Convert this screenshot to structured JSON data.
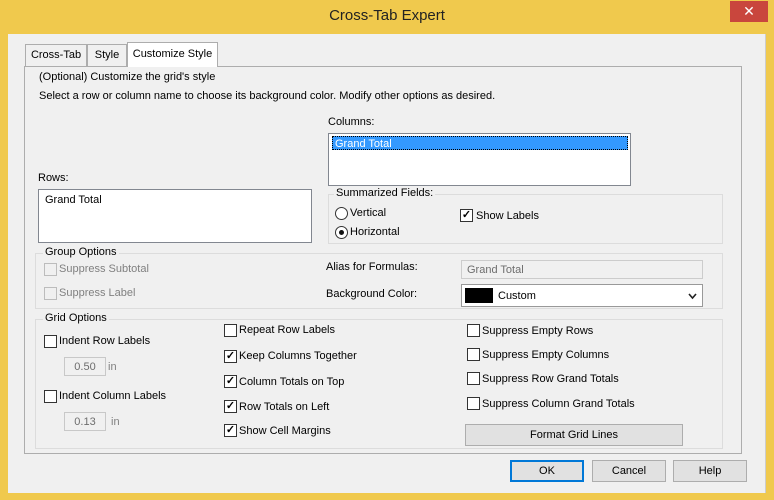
{
  "window": {
    "title": "Cross-Tab Expert",
    "close_glyph": "✕"
  },
  "tabs": [
    {
      "label": "Cross-Tab"
    },
    {
      "label": "Style"
    },
    {
      "label": "Customize Style",
      "active": true
    }
  ],
  "intro": {
    "line1": "(Optional) Customize the grid's style",
    "line2": "Select a row or column name to choose its background color.  Modify other options as desired."
  },
  "columns": {
    "label": "Columns:",
    "items": [
      "Grand Total"
    ],
    "selected": "Grand Total"
  },
  "rows": {
    "label": "Rows:",
    "items": [
      "Grand Total"
    ]
  },
  "summarized": {
    "legend": "Summarized Fields:",
    "vertical": {
      "label": "Vertical",
      "selected": false
    },
    "horizontal": {
      "label": "Horizontal",
      "selected": true
    },
    "show_labels": {
      "label": "Show Labels",
      "checked": true
    }
  },
  "group_options": {
    "legend": "Group Options",
    "suppress_subtotal": {
      "label": "Suppress Subtotal",
      "checked": false,
      "enabled": false
    },
    "suppress_label": {
      "label": "Suppress Label",
      "checked": false,
      "enabled": false
    },
    "alias_label": "Alias for Formulas:",
    "alias_value": "Grand Total",
    "bg_color_label": "Background Color:",
    "bg_color_value": "Custom",
    "bg_color_swatch": "#000000"
  },
  "grid_options": {
    "legend": "Grid  Options",
    "indent_row_labels": {
      "label": "Indent Row Labels",
      "checked": false
    },
    "indent_row_value": "0.50",
    "indent_row_unit": "in",
    "indent_col_labels": {
      "label": "Indent Column Labels",
      "checked": false
    },
    "indent_col_value": "0.13",
    "indent_col_unit": "in",
    "repeat_row_labels": {
      "label": "Repeat Row Labels",
      "checked": false
    },
    "keep_columns_together": {
      "label": "Keep Columns Together",
      "checked": true
    },
    "column_totals_on_top": {
      "label": "Column Totals on Top",
      "checked": true
    },
    "row_totals_on_left": {
      "label": "Row Totals on Left",
      "checked": true
    },
    "show_cell_margins": {
      "label": "Show Cell Margins",
      "checked": true
    },
    "suppress_empty_rows": {
      "label": "Suppress Empty Rows",
      "checked": false
    },
    "suppress_empty_columns": {
      "label": "Suppress Empty Columns",
      "checked": false
    },
    "suppress_row_grand_totals": {
      "label": "Suppress Row Grand Totals",
      "checked": false
    },
    "suppress_column_grand_totals": {
      "label": "Suppress Column Grand Totals",
      "checked": false
    },
    "format_grid_lines_label": "Format Grid Lines"
  },
  "buttons": {
    "ok": "OK",
    "cancel": "Cancel",
    "help": "Help"
  },
  "check_glyph": "✓",
  "colors": {
    "title_bar": "#f0c94d",
    "close_button": "#c9463d",
    "selection": "#3399ff",
    "dialog_bg": "#f0f0f0"
  }
}
